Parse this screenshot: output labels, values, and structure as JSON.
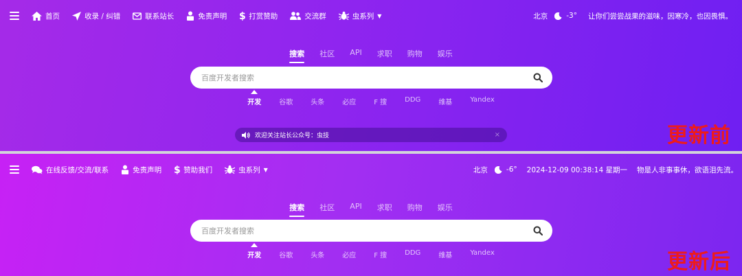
{
  "before": {
    "nav_items": [
      {
        "label": "首页",
        "icon": "home-icon"
      },
      {
        "label": "收录 / 纠错",
        "icon": "send-icon"
      },
      {
        "label": "联系站长",
        "icon": "mail-icon"
      },
      {
        "label": "免责声明",
        "icon": "hat-icon"
      },
      {
        "label": "打赏赞助",
        "icon": "dollar-icon"
      },
      {
        "label": "交流群",
        "icon": "users-icon"
      },
      {
        "label": "虫系列",
        "icon": "bug-icon"
      }
    ],
    "city": "北京",
    "temperature": "-3°",
    "quote": "让你们尝尝战果的滋味，因寒冷，也因畏惧。",
    "tabs": [
      "搜索",
      "社区",
      "API",
      "求职",
      "购物",
      "娱乐"
    ],
    "active_tab": "搜索",
    "search_placeholder": "百度开发者搜索",
    "engines": [
      "开发",
      "谷歌",
      "头条",
      "必应",
      "F 搜",
      "DDG",
      "维基",
      "Yandex"
    ],
    "notice_text": "欢迎关注站长公众号：虫技",
    "notice_close": "×",
    "stamp": "更新前"
  },
  "after": {
    "nav_items": [
      {
        "label": "在线反馈/交流/联系",
        "icon": "chat-icon"
      },
      {
        "label": "免责声明",
        "icon": "hat-icon"
      },
      {
        "label": "赞助我们",
        "icon": "dollar-icon"
      },
      {
        "label": "虫系列",
        "icon": "bug-icon"
      }
    ],
    "city": "北京",
    "temperature": "-6°",
    "datetime": "2024-12-09 00:38:14 星期一",
    "quote": "物是人非事事休，欲语泪先流。",
    "tabs": [
      "搜索",
      "社区",
      "API",
      "求职",
      "购物",
      "娱乐"
    ],
    "active_tab": "搜索",
    "search_placeholder": "百度开发者搜索",
    "engines": [
      "开发",
      "谷歌",
      "头条",
      "必应",
      "F 搜",
      "DDG",
      "维基",
      "Yandex"
    ],
    "stamp": "更新后"
  },
  "colors": {
    "stamp": "#ee1b1b",
    "before_gradient": [
      "#a52ae8",
      "#6f1ff2"
    ],
    "after_gradient": [
      "#c721f5",
      "#7c26f0"
    ]
  }
}
